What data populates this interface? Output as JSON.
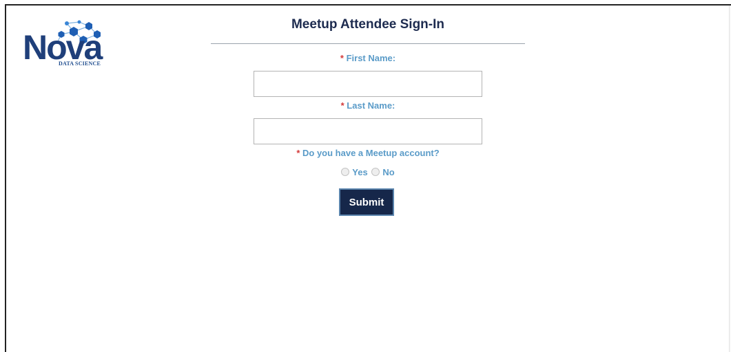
{
  "logo": {
    "word": "Nova",
    "subtitle": "DATA SCIENCE"
  },
  "page": {
    "title": "Meetup Attendee Sign-In"
  },
  "form": {
    "required_mark": "*",
    "first_name": {
      "label": "First Name:",
      "value": "",
      "placeholder": ""
    },
    "last_name": {
      "label": "Last Name:",
      "value": "",
      "placeholder": ""
    },
    "meetup_account": {
      "question": "Do you have a Meetup account?",
      "options": [
        "Yes",
        "No"
      ],
      "selected": null
    },
    "submit_label": "Submit"
  },
  "colors": {
    "title": "#1d2b4f",
    "label": "#5a9bc8",
    "required": "#d33a3a",
    "button_bg": "#16274a",
    "button_border": "#5a84ad",
    "logo_blue": "#1f3f7a"
  }
}
